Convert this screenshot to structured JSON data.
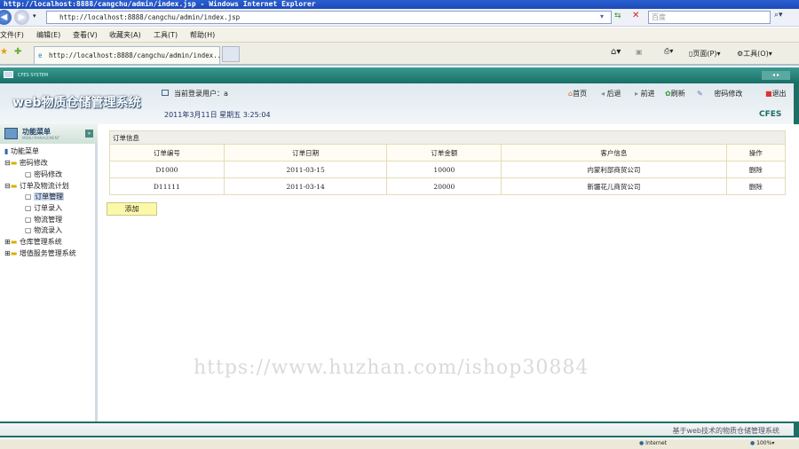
{
  "browser": {
    "title": "http://localhost:8888/cangchu/admin/index.jsp - Windows Internet Explorer",
    "address": "http://localhost:8888/cangchu/admin/index.jsp",
    "search_placeholder": "百度",
    "menu": [
      "文件(F)",
      "编辑(E)",
      "查看(V)",
      "收藏夹(A)",
      "工具(T)",
      "帮助(H)"
    ],
    "tab_label": "http://localhost:8888/cangchu/admin/index...",
    "cmd_page": "页面(P)",
    "cmd_tools": "工具(O)",
    "status_zone": "Internet",
    "zoom": "100%"
  },
  "app": {
    "bar_label": "CFES SYSTEM",
    "logo": "web物质仓储管理系统",
    "user_line": "当前登录用户：a",
    "date_line": "2011年3月11日  星期五  3:25:04",
    "toolbar": {
      "home": "首页",
      "back": "后退",
      "forward": "前进",
      "refresh": "刷新",
      "password": "密码修改",
      "logout": "退出"
    },
    "brand": "CFES",
    "footer": "基于web技术的物质仓储管理系统"
  },
  "sidebar": {
    "title": "功能菜单",
    "subtitle": "MENU MANAGEMENT",
    "root": "功能菜单",
    "groups": [
      {
        "label": "密码修改",
        "items": [
          "密码修改"
        ]
      },
      {
        "label": "订单及物流计划",
        "items": [
          "订单管理",
          "订单录入",
          "物流管理",
          "物流录入"
        ]
      },
      {
        "label": "仓库管理系统",
        "items": []
      },
      {
        "label": "增值服务管理系统",
        "items": []
      }
    ]
  },
  "orders": {
    "caption": "订单信息",
    "columns": [
      "订单编号",
      "订单日期",
      "订单金额",
      "客户信息",
      "操作"
    ],
    "rows": [
      [
        "D1000",
        "2011-03-15",
        "10000",
        "内蒙利部商贸公司",
        "删除"
      ],
      [
        "D11111",
        "2011-03-14",
        "20000",
        "新疆花儿商贸公司",
        "删除"
      ]
    ],
    "add_label": "添加"
  },
  "watermark": "https://www.huzhan.com/ishop30884"
}
